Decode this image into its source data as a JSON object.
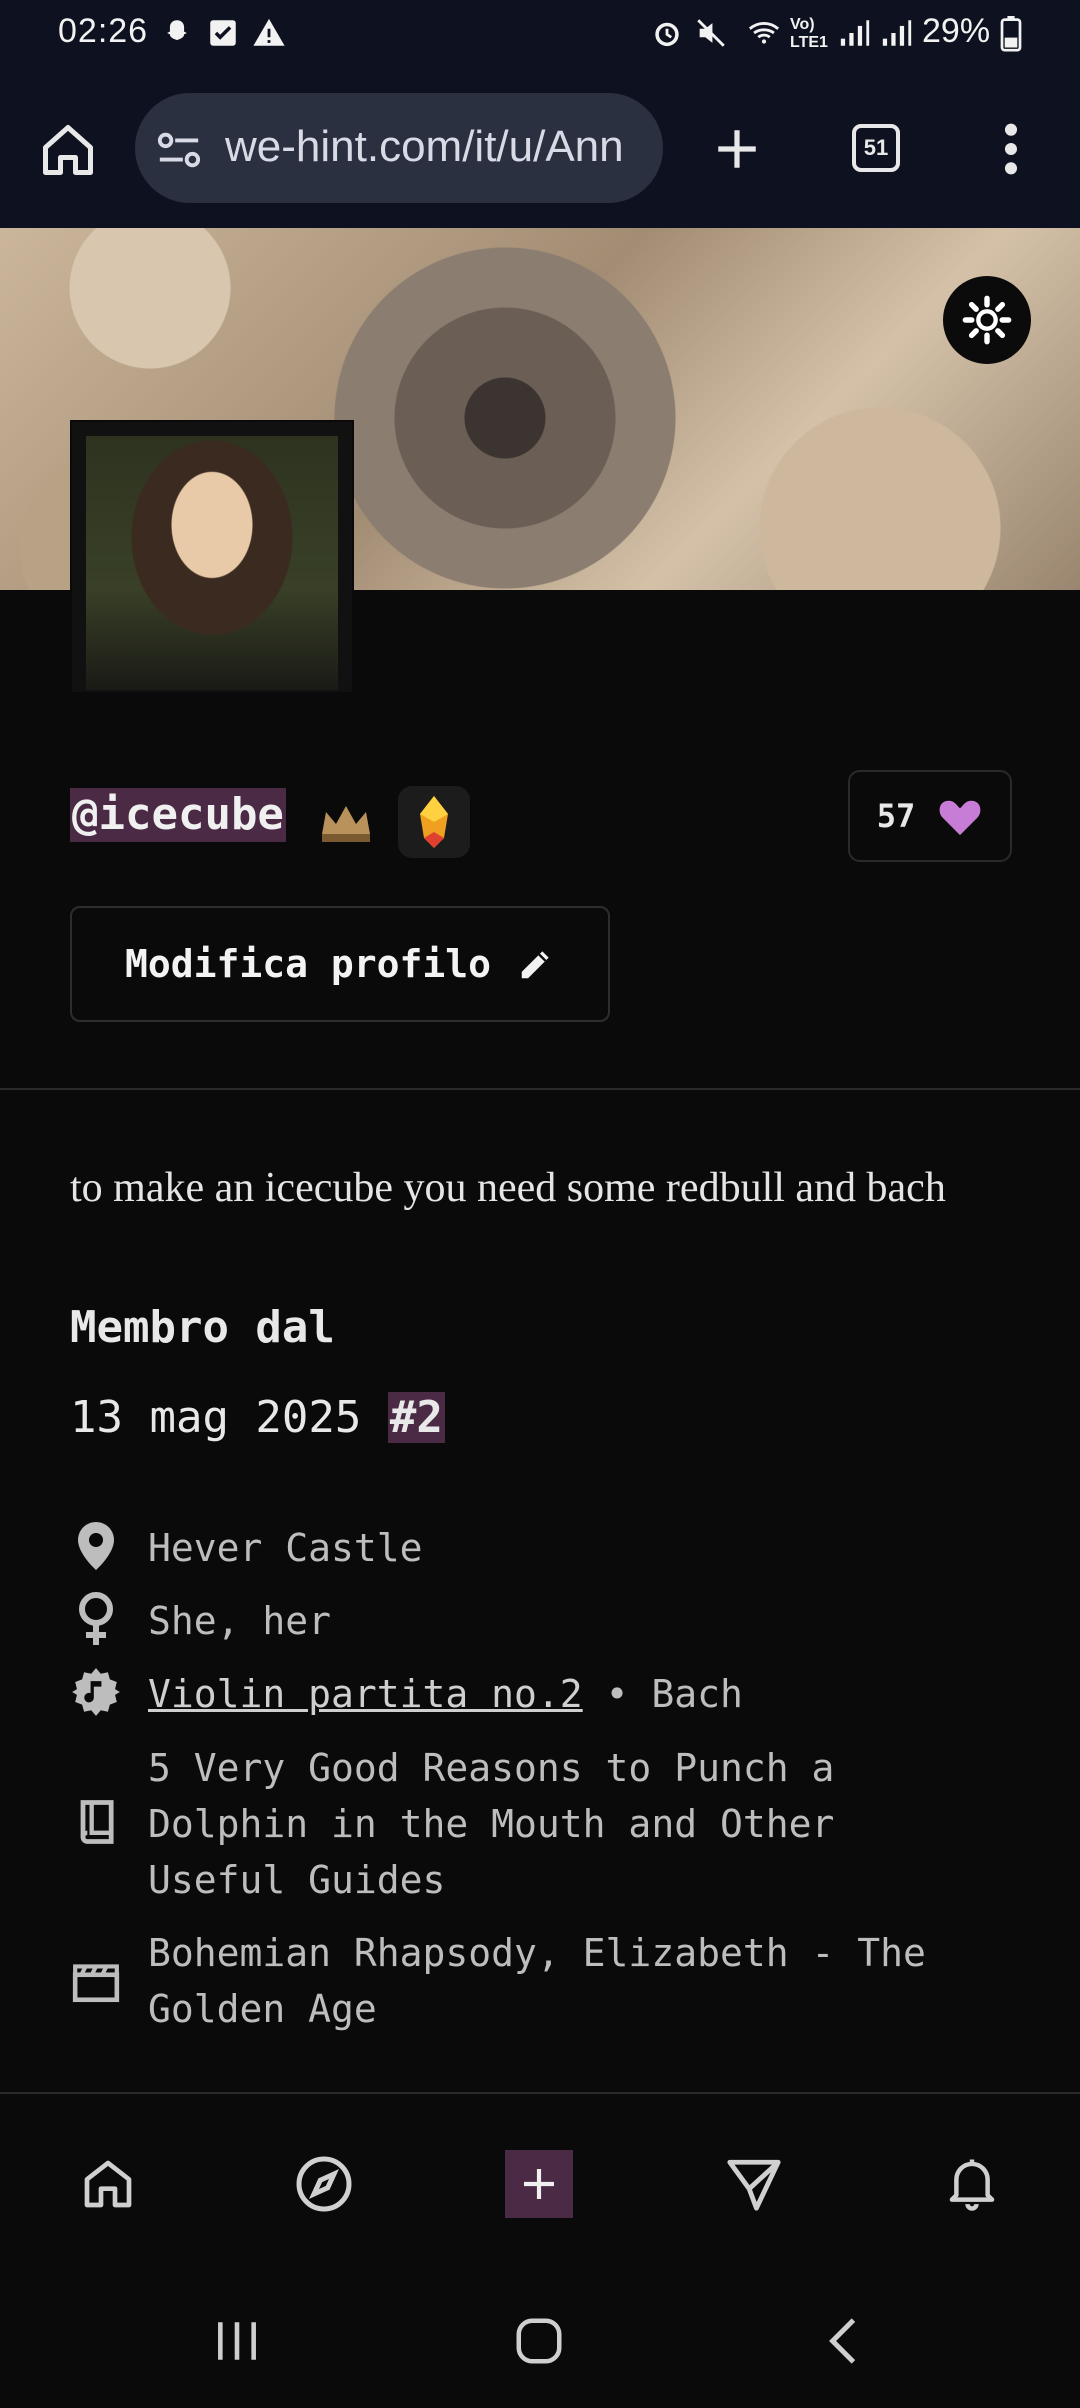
{
  "status_bar": {
    "time": "02:26",
    "battery": "29%"
  },
  "browser": {
    "url": "we-hint.com/it/u/Ann",
    "tab_count": "51"
  },
  "profile": {
    "username": "@icecube",
    "likes": "57",
    "edit_label": "Modifica profilo",
    "bio": "to make an icecube you need some redbull and bach",
    "member_since_label": "Membro dal",
    "member_since_date": "13 mag 2025",
    "member_rank": "#2",
    "info": {
      "location": "Hever Castle",
      "pronouns": "She, her",
      "music_title": "Violin partita no.2",
      "music_sep": " • ",
      "music_artist": "Bach",
      "book": "5 Very Good Reasons to Punch a Dolphin in the Mouth and Other Useful Guides",
      "films": "Bohemian Rhapsody, Elizabeth - The Golden Age"
    }
  },
  "colors": {
    "accent": "#4a2a44",
    "heart": "#c77dd6",
    "background": "#0a0a0a"
  }
}
